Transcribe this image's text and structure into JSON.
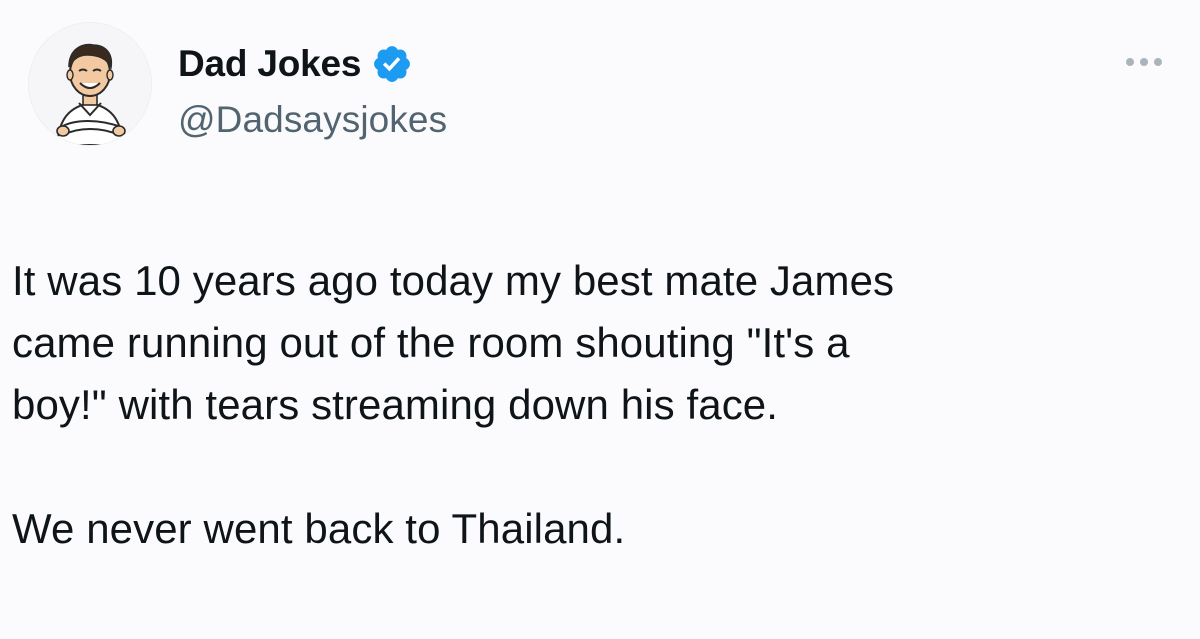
{
  "tweet": {
    "author": {
      "display_name": "Dad Jokes",
      "handle": "@Dadsaysjokes",
      "verified": true,
      "verified_badge_icon": "verified-checkmark-icon",
      "verified_badge_color": "#1d9bf0",
      "avatar_icon": "cartoon-man-avatar-icon"
    },
    "more_icon": "more-options-icon",
    "text_lines": [
      "It was 10 years ago today my best mate James",
      "came running out of the room shouting \"It's a",
      "boy!\" with tears streaming down his face."
    ],
    "punchline": "We never went back to Thailand."
  }
}
